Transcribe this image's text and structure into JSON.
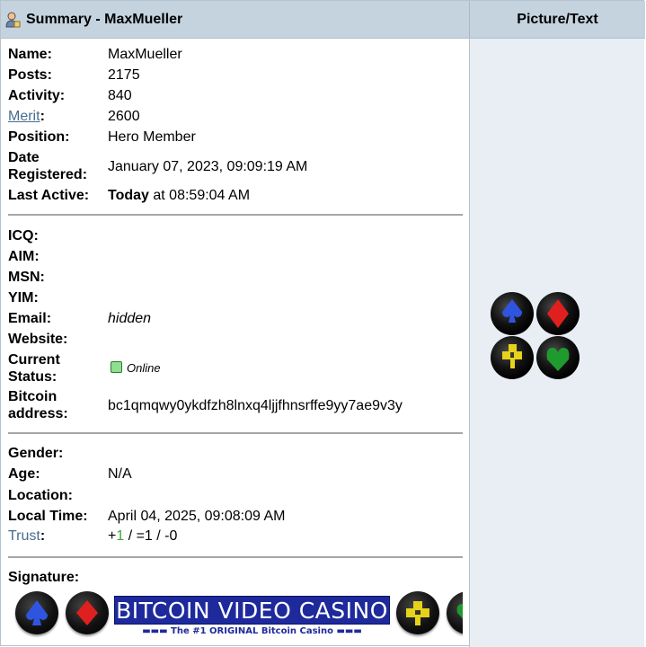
{
  "header": {
    "summary_title": "Summary - MaxMueller",
    "picture_title": "Picture/Text"
  },
  "profile": {
    "name_label": "Name:",
    "name": "MaxMueller",
    "posts_label": "Posts:",
    "posts": "2175",
    "activity_label": "Activity:",
    "activity": "840",
    "merit_link": "Merit",
    "merit_colon": ":",
    "merit": "2600",
    "position_label": "Position:",
    "position": "Hero Member",
    "date_registered_label_1": "Date",
    "date_registered_label_2": "Registered:",
    "date_registered": "January 07, 2023, 09:09:19 AM",
    "last_active_label": "Last Active:",
    "last_active_today": "Today",
    "last_active_time": " at 08:59:04 AM"
  },
  "contact": {
    "icq_label": "ICQ:",
    "aim_label": "AIM:",
    "msn_label": "MSN:",
    "yim_label": "YIM:",
    "email_label": "Email:",
    "email": "hidden",
    "website_label": "Website:",
    "status_label_1": "Current",
    "status_label_2": "Status:",
    "status": "Online",
    "bitcoin_label_1": "Bitcoin",
    "bitcoin_label_2": "address:",
    "bitcoin_address": "bc1qmqwy0ykdfzh8lnxq4ljjfhnsrffe9yy7ae9v3y"
  },
  "details": {
    "gender_label": "Gender:",
    "age_label": "Age:",
    "age": "N/A",
    "location_label": "Location:",
    "local_time_label": "Local Time:",
    "local_time": "April 04, 2025, 09:08:09 AM",
    "trust_link": "Trust",
    "trust_colon": ":",
    "trust_plus": "+",
    "trust_positive": "1",
    "trust_rest": " / =1 / -0"
  },
  "signature": {
    "label": "Signature:",
    "banner_title": "BITCOIN VIDEO CASINO",
    "banner_subtitle": "▬▬▬ The #1 ORIGINAL Bitcoin Casino ▬▬▬"
  },
  "colors": {
    "header_bg": "#c5d3df",
    "right_column_bg": "#e8eef3",
    "link": "#476c8e",
    "trust_positive": "#3fa33f",
    "spade": "#2f55e0",
    "diamond": "#e0201e",
    "club": "#e6d21a",
    "heart": "#1f9a2f"
  },
  "icons": {
    "avatar_suits": [
      "spade-icon",
      "diamond-icon",
      "club-icon",
      "heart-icon"
    ]
  }
}
